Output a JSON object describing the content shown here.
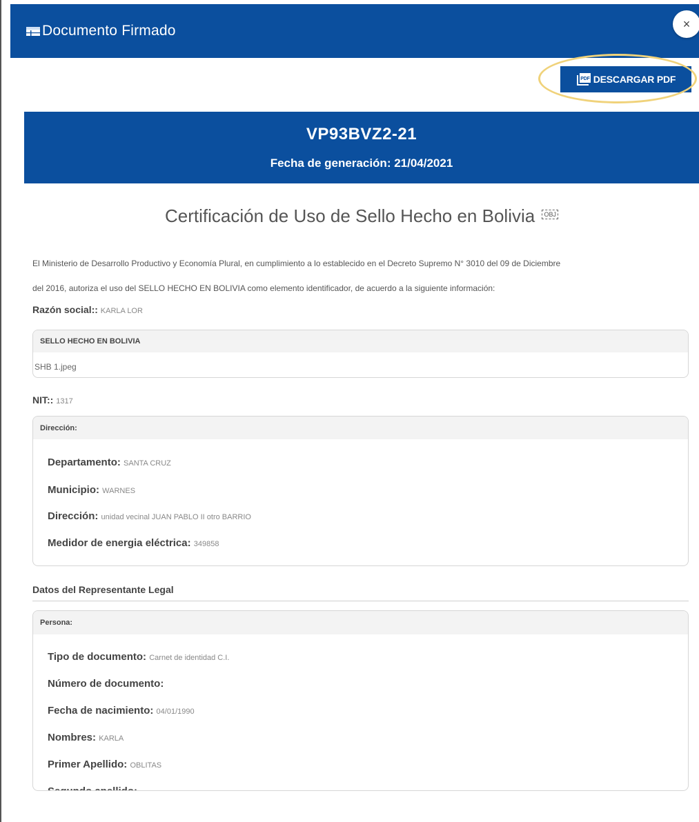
{
  "modal": {
    "title": "Documento Firmado",
    "close_label": "×"
  },
  "toolbar": {
    "download_label": "DESCARGAR PDF",
    "download_icon_text": "PDF"
  },
  "banner": {
    "code": "VP93BVZ2-21",
    "generation_date": "Fecha de generación: 21/04/2021"
  },
  "certificate": {
    "title": "Certificación de Uso de Sello Hecho en Bolivia",
    "title_icon_text": "OBJ",
    "intro_line1": "El Ministerio de Desarrollo Productivo y Economía Plural, en cumplimiento a lo establecido en el Decreto Supremo N° 3010 del 09 de Diciembre",
    "intro_line2": "del 2016, autoriza el uso del SELLO HECHO EN BOLIVIA como elemento identificador, de acuerdo a la siguiente información:"
  },
  "razon_social": {
    "label": "Razón social::",
    "value": "KARLA LOR"
  },
  "sello": {
    "header": "SELLO HECHO EN BOLIVIA",
    "file": "SHB 1.jpeg"
  },
  "nit": {
    "label": "NIT::",
    "value": "1317"
  },
  "direccion": {
    "header": "Dirección:",
    "departamento_label": "Departamento:",
    "departamento_value": "SANTA CRUZ",
    "municipio_label": "Municipio:",
    "municipio_value": "WARNES",
    "direccion_label": "Dirección:",
    "direccion_value": "unidad vecinal JUAN PABLO II otro BARRIO",
    "medidor_label": "Medidor de energia eléctrica:",
    "medidor_value": "349858"
  },
  "representante": {
    "section_title": "Datos del Representante Legal",
    "header": "Persona:",
    "tipo_label": "Tipo de documento:",
    "tipo_value": "Carnet de identidad C.I.",
    "numero_label": "Número de documento:",
    "numero_value": "",
    "nacimiento_label": "Fecha de nacimiento:",
    "nacimiento_value": "04/01/1990",
    "nombres_label": "Nombres:",
    "nombres_value": "KARLA",
    "primer_label": "Primer Apellido:",
    "primer_value": "OBLITAS",
    "segundo_label": "Segundo apellido:",
    "segundo_value": ""
  },
  "colors": {
    "primary": "#0b4f9e",
    "highlight": "#f0d27a"
  }
}
